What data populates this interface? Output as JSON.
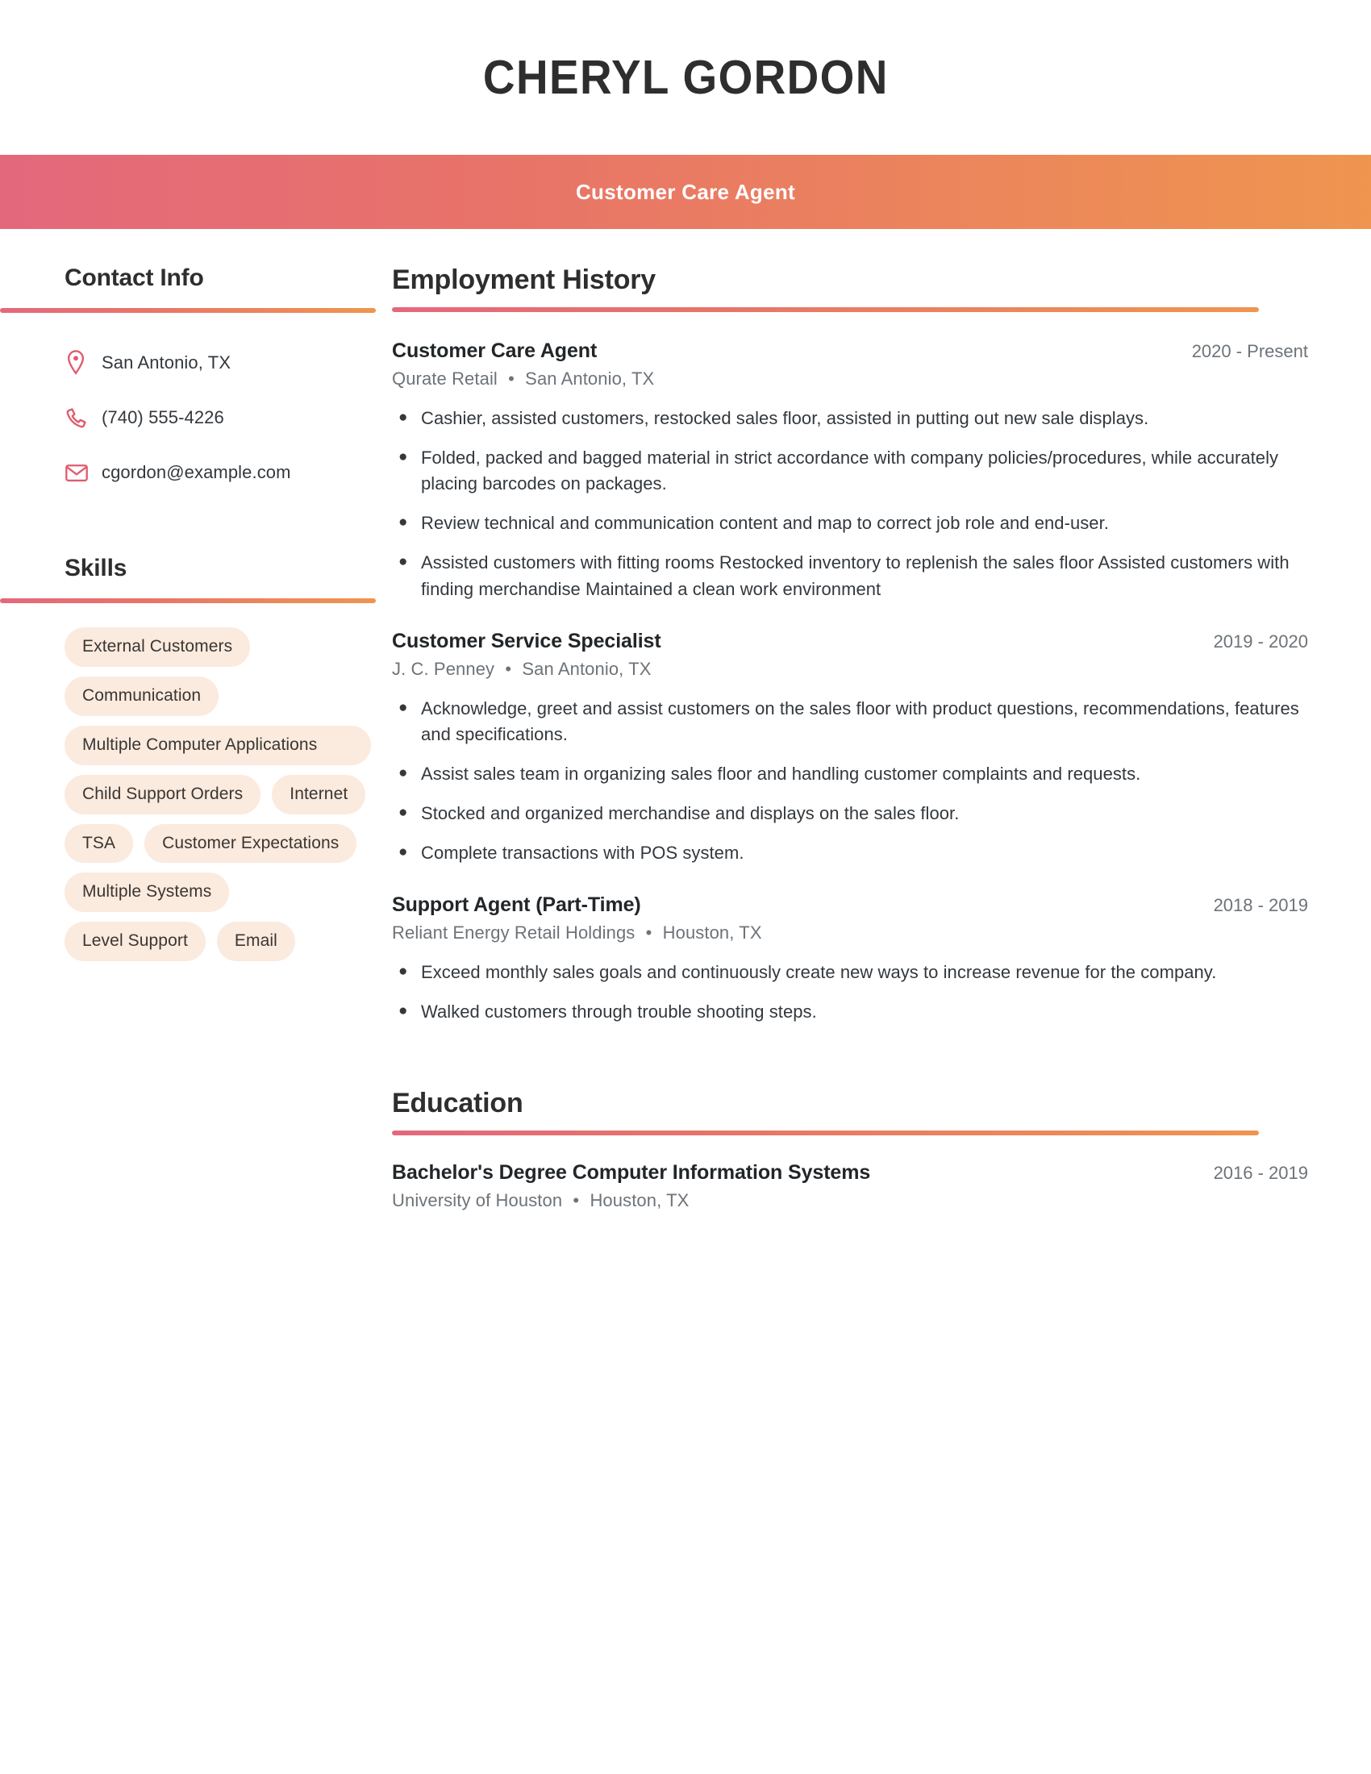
{
  "header": {
    "name": "CHERYL GORDON",
    "title": "Customer Care Agent"
  },
  "sidebar": {
    "contact": {
      "heading": "Contact Info",
      "items": [
        {
          "icon": "location-pin-icon",
          "value": "San Antonio, TX"
        },
        {
          "icon": "phone-icon",
          "value": "(740) 555-4226"
        },
        {
          "icon": "email-envelope-icon",
          "value": "cgordon@example.com"
        }
      ]
    },
    "skills": {
      "heading": "Skills",
      "tags": [
        "External Customers",
        "Communication",
        "Multiple Computer Applications",
        "Child Support Orders",
        "Internet",
        "TSA",
        "Customer Expectations",
        "Multiple Systems",
        "Level Support",
        "Email"
      ]
    }
  },
  "main": {
    "employment": {
      "heading": "Employment History",
      "entries": [
        {
          "title": "Customer Care Agent",
          "dates": "2020 - Present",
          "company": "Qurate Retail",
          "location": "San Antonio, TX",
          "bullets": [
            "Cashier, assisted customers, restocked sales floor, assisted in putting out new sale displays.",
            "Folded, packed and bagged material in strict accordance with company policies/procedures, while accurately placing barcodes on packages.",
            "Review technical and communication content and map to correct job role and end-user.",
            "Assisted customers with fitting rooms Restocked inventory to replenish the sales floor Assisted customers with finding merchandise Maintained a clean work environment"
          ]
        },
        {
          "title": "Customer Service Specialist",
          "dates": "2019 - 2020",
          "company": "J. C. Penney",
          "location": "San Antonio, TX",
          "bullets": [
            "Acknowledge, greet and assist customers on the sales floor with product questions, recommendations, features and specifications.",
            "Assist sales team in organizing sales floor and handling customer complaints and requests.",
            "Stocked and organized merchandise and displays on the sales floor.",
            "Complete transactions with POS system."
          ]
        },
        {
          "title": "Support Agent (Part-Time)",
          "dates": "2018 - 2019",
          "company": "Reliant Energy Retail Holdings",
          "location": "Houston, TX",
          "bullets": [
            "Exceed monthly sales goals and continuously create new ways to increase revenue for the company.",
            "Walked customers through trouble shooting steps."
          ]
        }
      ]
    },
    "education": {
      "heading": "Education",
      "entries": [
        {
          "title": "Bachelor's Degree Computer Information Systems",
          "dates": "2016 - 2019",
          "school": "University of Houston",
          "location": "Houston, TX"
        }
      ]
    }
  },
  "separator": "•",
  "bullet_glyph": "●",
  "colors": {
    "gradient_start": "#e4687c",
    "gradient_mid": "#e87468",
    "gradient_end": "#ef9550",
    "icon": "#e05c6e",
    "tag_bg": "#fbeade",
    "heading": "#2e2e2e",
    "muted_text": "#6d7378",
    "body_text": "#33383d"
  }
}
